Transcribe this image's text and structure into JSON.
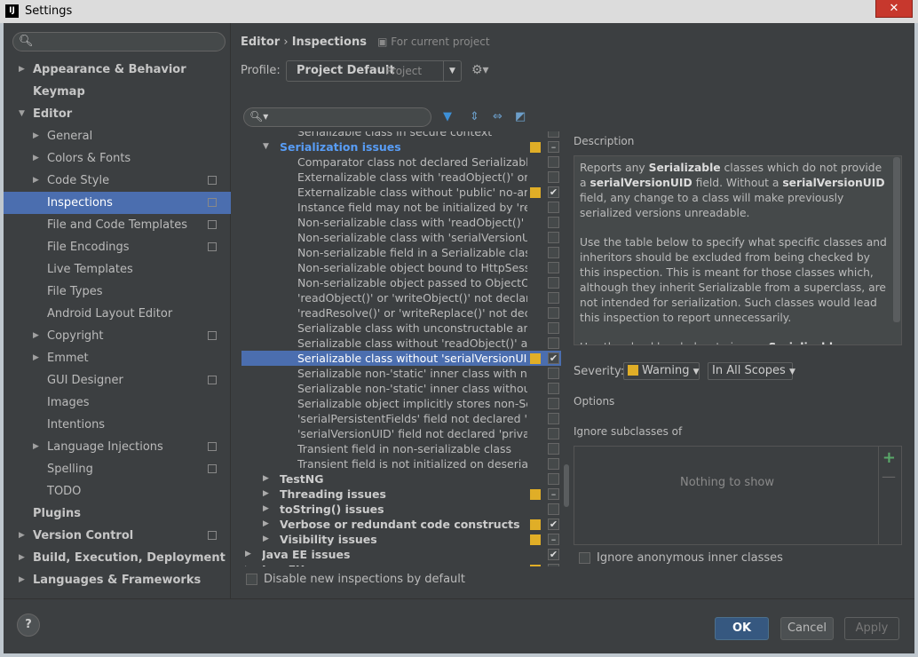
{
  "window": {
    "title": "Settings",
    "close_label": "✕",
    "app_icon": "IJ"
  },
  "sidebar": {
    "search_placeholder": "",
    "items": [
      {
        "label": "Appearance & Behavior",
        "level": 0,
        "arrow": "▶",
        "bold": true
      },
      {
        "label": "Keymap",
        "level": 0,
        "bold": true
      },
      {
        "label": "Editor",
        "level": 0,
        "arrow": "▼",
        "bold": true
      },
      {
        "label": "General",
        "level": 1,
        "arrow": "▶"
      },
      {
        "label": "Colors & Fonts",
        "level": 1,
        "arrow": "▶"
      },
      {
        "label": "Code Style",
        "level": 1,
        "arrow": "▶",
        "badge": true
      },
      {
        "label": "Inspections",
        "level": 1,
        "badge": true,
        "selected": true
      },
      {
        "label": "File and Code Templates",
        "level": 1,
        "badge": true
      },
      {
        "label": "File Encodings",
        "level": 1,
        "badge": true
      },
      {
        "label": "Live Templates",
        "level": 1
      },
      {
        "label": "File Types",
        "level": 1
      },
      {
        "label": "Android Layout Editor",
        "level": 1
      },
      {
        "label": "Copyright",
        "level": 1,
        "arrow": "▶",
        "badge": true
      },
      {
        "label": "Emmet",
        "level": 1,
        "arrow": "▶"
      },
      {
        "label": "GUI Designer",
        "level": 1,
        "badge": true
      },
      {
        "label": "Images",
        "level": 1
      },
      {
        "label": "Intentions",
        "level": 1
      },
      {
        "label": "Language Injections",
        "level": 1,
        "arrow": "▶",
        "badge": true
      },
      {
        "label": "Spelling",
        "level": 1,
        "badge": true
      },
      {
        "label": "TODO",
        "level": 1
      },
      {
        "label": "Plugins",
        "level": 0,
        "bold": true
      },
      {
        "label": "Version Control",
        "level": 0,
        "arrow": "▶",
        "bold": true,
        "badge": true
      },
      {
        "label": "Build, Execution, Deployment",
        "level": 0,
        "arrow": "▶",
        "bold": true
      },
      {
        "label": "Languages & Frameworks",
        "level": 0,
        "arrow": "▶",
        "bold": true
      }
    ]
  },
  "breadcrumb": {
    "parent": "Editor",
    "sep": "›",
    "current": "Inspections",
    "scope": "For current project"
  },
  "profile": {
    "label": "Profile:",
    "value": "Project Default",
    "sub": "Project"
  },
  "inspections": {
    "rows": [
      {
        "text": "Serializable class in secure context",
        "kind": "item"
      },
      {
        "text": "Serialization issues",
        "kind": "group-hi",
        "arrow": "▼",
        "sev": true,
        "check": "–"
      },
      {
        "text": "Comparator class not declared Serializable",
        "kind": "item"
      },
      {
        "text": "Externalizable class with 'readObject()' or 'wr",
        "kind": "item"
      },
      {
        "text": "Externalizable class without 'public' no-arg c",
        "kind": "item",
        "sev": true,
        "check": "✔"
      },
      {
        "text": "Instance field may not be initialized by 'read",
        "kind": "item"
      },
      {
        "text": "Non-serializable class with 'readObject()' or",
        "kind": "item"
      },
      {
        "text": "Non-serializable class with 'serialVersionUID",
        "kind": "item"
      },
      {
        "text": "Non-serializable field in a Serializable class",
        "kind": "item"
      },
      {
        "text": "Non-serializable object bound to HttpSessio",
        "kind": "item"
      },
      {
        "text": "Non-serializable object passed to ObjectOut",
        "kind": "item"
      },
      {
        "text": "'readObject()' or 'writeObject()' not declared",
        "kind": "item"
      },
      {
        "text": "'readResolve()' or 'writeReplace()' not declar",
        "kind": "item"
      },
      {
        "text": "Serializable class with unconstructable ances",
        "kind": "item"
      },
      {
        "text": "Serializable class without 'readObject()' and",
        "kind": "item"
      },
      {
        "text": "Serializable class without 'serialVersionUID'",
        "kind": "item",
        "selected": true,
        "sev": true,
        "check": "✔"
      },
      {
        "text": "Serializable non-'static' inner class with non-S",
        "kind": "item"
      },
      {
        "text": "Serializable non-'static' inner class without 's",
        "kind": "item"
      },
      {
        "text": "Serializable object implicitly stores non-Seria",
        "kind": "item"
      },
      {
        "text": "'serialPersistentFields' field not declared 'priv",
        "kind": "item"
      },
      {
        "text": "'serialVersionUID' field not declared 'private",
        "kind": "item"
      },
      {
        "text": "Transient field in non-serializable class",
        "kind": "item"
      },
      {
        "text": "Transient field is not initialized on deserializa",
        "kind": "item"
      },
      {
        "text": "TestNG",
        "kind": "group",
        "arrow": "▶"
      },
      {
        "text": "Threading issues",
        "kind": "group",
        "arrow": "▶",
        "sev": true,
        "check": "–"
      },
      {
        "text": "toString() issues",
        "kind": "group",
        "arrow": "▶"
      },
      {
        "text": "Verbose or redundant code constructs",
        "kind": "group",
        "arrow": "▶",
        "sev": true,
        "check": "✔"
      },
      {
        "text": "Visibility issues",
        "kind": "group",
        "arrow": "▶",
        "sev": true,
        "check": "–"
      },
      {
        "text": "Java EE issues",
        "kind": "group-top",
        "arrow": "▶",
        "check": "✔"
      },
      {
        "text": "JavaFX",
        "kind": "group-top",
        "arrow": "▶",
        "sev": true
      }
    ]
  },
  "disable_new": {
    "label": "Disable new inspections by default",
    "checked": false
  },
  "description": {
    "title": "Description",
    "p1": [
      {
        "t": "Reports any "
      },
      {
        "b": "Serializable"
      },
      {
        "t": " classes which do not provide a "
      },
      {
        "b": "serialVersionUID"
      },
      {
        "t": " field. Without a "
      },
      {
        "b": "serialVersionUID"
      },
      {
        "t": " field, any change to a class will make previously serialized versions unreadable."
      }
    ],
    "p2": "Use the table below to specify what specific classes and inheritors should be excluded from being checked by this inspection. This is meant for those classes which, although they inherit Serializable from a superclass, are not intended for serialization. Such classes would lead this inspection to report unnecessarily.",
    "p3": [
      {
        "t": "Use the checkbox below to ignore "
      },
      {
        "b": "Serializable"
      }
    ]
  },
  "severity": {
    "label": "Severity:",
    "value": "Warning",
    "scope": "In All Scopes",
    "color": "#e0ae27"
  },
  "options": {
    "title": "Options",
    "ignore_subclasses_label": "Ignore subclasses of",
    "empty_text": "Nothing to show",
    "add": "+",
    "remove": "—",
    "ignore_anonymous_label": "Ignore anonymous inner classes"
  },
  "buttons": {
    "help": "?",
    "ok": "OK",
    "cancel": "Cancel",
    "apply": "Apply"
  },
  "colors": {
    "accent": "#4b6eaf",
    "group_highlight": "#589df6",
    "warning": "#e0ae27",
    "add": "#59a869"
  }
}
